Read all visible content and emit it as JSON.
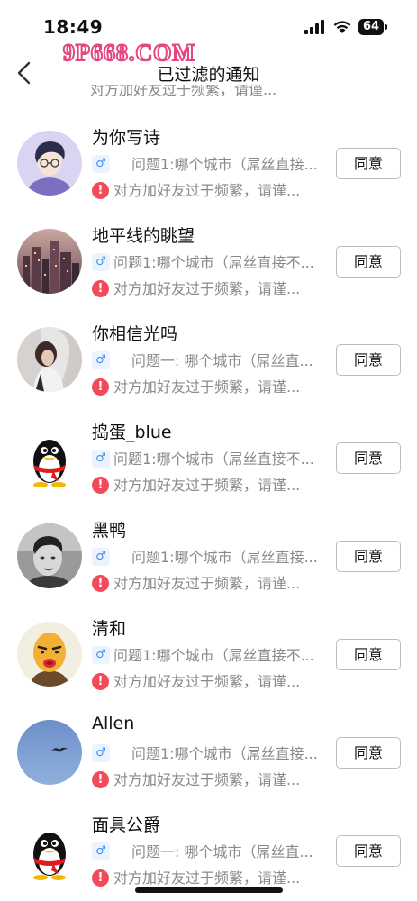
{
  "status_bar": {
    "time": "18:49",
    "battery": "64"
  },
  "nav": {
    "title": "已过滤的通知",
    "watermark": "9P668.COM"
  },
  "partial_top_text": "对方加好友过于频繁，请谨...",
  "agree_label": "同意",
  "gender_symbol": "♂",
  "warn_symbol": "!",
  "items": [
    {
      "name": "为你写诗",
      "question": "问题1:哪个城市（屌丝直接...",
      "warning": "对方加好友过于频繁，请谨...",
      "avatar": "avatar-cartoon-glasses"
    },
    {
      "name": "地平线的眺望",
      "question": "问题1:哪个城市（屌丝直接不...",
      "warning": "对方加好友过于频繁，请谨...",
      "avatar": "avatar-city-night"
    },
    {
      "name": "你相信光吗",
      "question": "问题一: 哪个城市（屌丝直...",
      "warning": "对方加好友过于频繁，请谨...",
      "avatar": "avatar-photo-person"
    },
    {
      "name": "捣蛋_blue",
      "question": "问题1:哪个城市（屌丝直接不...",
      "warning": "对方加好友过于频繁，请谨...",
      "avatar": "avatar-qq-penguin"
    },
    {
      "name": "黑鸭",
      "question": "问题1:哪个城市（屌丝直接...",
      "warning": "对方加好友过于频繁，请谨...",
      "avatar": "avatar-bw-man"
    },
    {
      "name": "清和",
      "question": "问题1:哪个城市（屌丝直接不...",
      "warning": "对方加好友过于频繁，请谨...",
      "avatar": "avatar-cartoon-bald"
    },
    {
      "name": "Allen",
      "question": "问题1:哪个城市（屌丝直接...",
      "warning": "对方加好友过于频繁，请谨...",
      "avatar": "avatar-blue-sky-bird"
    },
    {
      "name": "面具公爵",
      "question": "问题一: 哪个城市（屌丝直...",
      "warning": "对方加好友过于频繁，请谨...",
      "avatar": "avatar-qq-penguin"
    }
  ]
}
